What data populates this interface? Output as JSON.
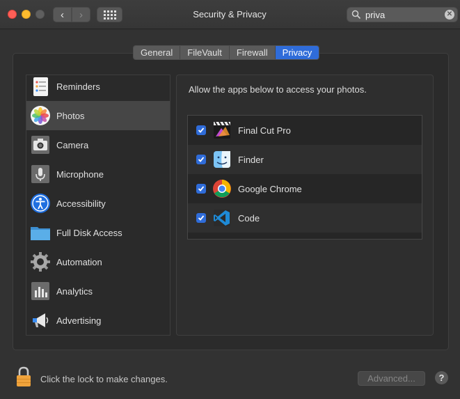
{
  "window": {
    "title": "Security & Privacy"
  },
  "search": {
    "value": "priva"
  },
  "tabs": [
    {
      "label": "General"
    },
    {
      "label": "FileVault"
    },
    {
      "label": "Firewall"
    },
    {
      "label": "Privacy",
      "active": true
    }
  ],
  "sidebar": {
    "items": [
      {
        "label": "Reminders",
        "icon": "reminders-icon"
      },
      {
        "label": "Photos",
        "icon": "photos-icon",
        "selected": true
      },
      {
        "label": "Camera",
        "icon": "camera-icon"
      },
      {
        "label": "Microphone",
        "icon": "microphone-icon"
      },
      {
        "label": "Accessibility",
        "icon": "accessibility-icon"
      },
      {
        "label": "Full Disk Access",
        "icon": "folder-icon"
      },
      {
        "label": "Automation",
        "icon": "gear-icon"
      },
      {
        "label": "Analytics",
        "icon": "analytics-icon"
      },
      {
        "label": "Advertising",
        "icon": "megaphone-icon"
      }
    ]
  },
  "panel": {
    "description": "Allow the apps below to access your photos.",
    "apps": [
      {
        "name": "Final Cut Pro",
        "checked": true,
        "icon": "final-cut-pro-icon"
      },
      {
        "name": "Finder",
        "checked": true,
        "icon": "finder-icon"
      },
      {
        "name": "Google Chrome",
        "checked": true,
        "icon": "chrome-icon"
      },
      {
        "name": "Code",
        "checked": true,
        "icon": "vscode-icon"
      }
    ]
  },
  "footer": {
    "lock_text": "Click the lock to make changes.",
    "advanced_label": "Advanced...",
    "help_label": "?"
  },
  "colors": {
    "accent": "#2f6cd9",
    "background": "#323232"
  }
}
